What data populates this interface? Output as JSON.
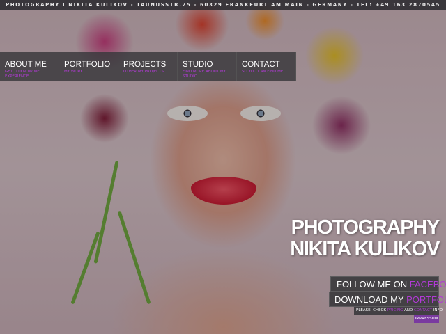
{
  "top_bar": {
    "text": "PHOTOGRAPHY I NIKITA KULIKOV - TAUNUSSTR.25 - 60329 FRANKFURT AM MAIN - GERMANY - TEL: +49 163 2870545"
  },
  "nav": {
    "items": [
      {
        "label": "ABOUT ME",
        "sub": "GET TO KNOW ME, EXPERIENCE"
      },
      {
        "label": "PORTFOLIO",
        "sub": "MY WORK"
      },
      {
        "label": "PROJECTS",
        "sub": "OTHER MY PROJECTS"
      },
      {
        "label": "STUDIO",
        "sub": "FIND MORE ABOUT MY STUDIO"
      },
      {
        "label": "CONTACT",
        "sub": "SO YOU CAN FIND ME"
      }
    ]
  },
  "hero": {
    "line1": "PHOTOGRAPHY",
    "line2": "NIKITA KULIKOV"
  },
  "buttons": {
    "follow_prefix": "FOLLOW ME ON",
    "follow_accent": "FACEBOOK",
    "download_prefix": "DOWNLOAD MY",
    "download_accent": "PORTFOLIO"
  },
  "footer_note": {
    "prefix": "PLEASE, CHECK",
    "link1": "PRICING",
    "middle": "AND",
    "link2": "CONTACT",
    "suffix": "INFO"
  },
  "imprint": "IMPRESSUM",
  "colors": {
    "accent": "#b23ad6",
    "nav_bg": "#37373a"
  }
}
